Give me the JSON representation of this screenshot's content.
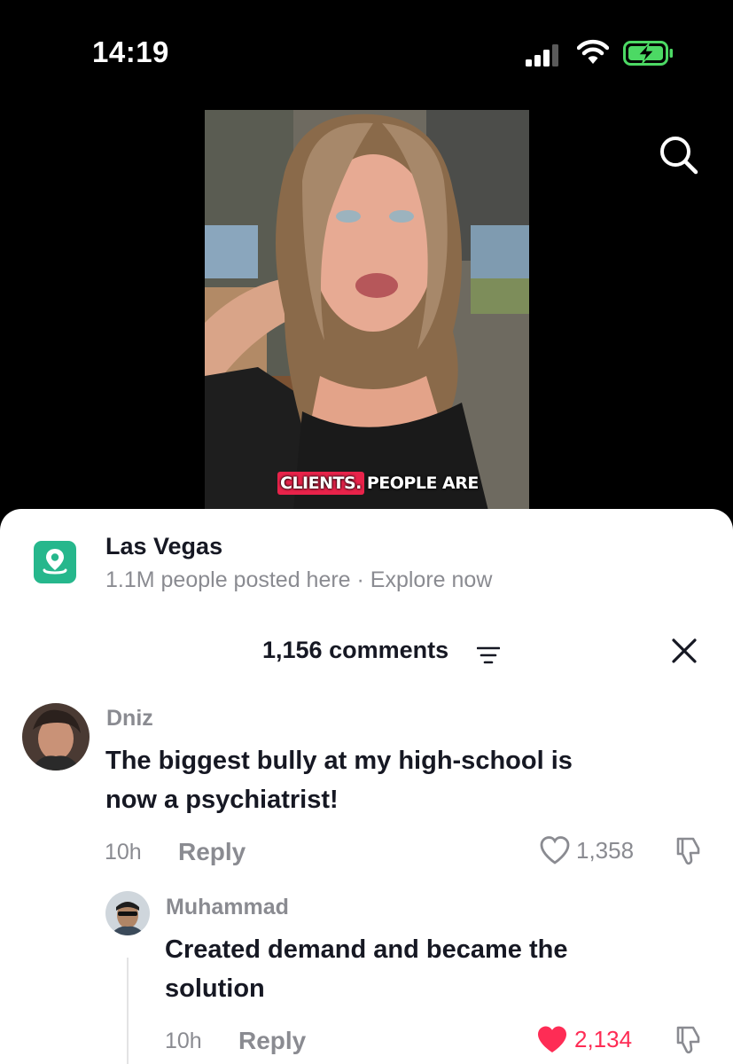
{
  "status": {
    "time": "14:19"
  },
  "video": {
    "caption_highlight": "CLIENTS.",
    "caption_rest": "PEOPLE ARE"
  },
  "location": {
    "name": "Las Vegas",
    "subtitle": "1.1M people posted here · Explore now"
  },
  "comments_header": {
    "count_label": "1,156 comments"
  },
  "comments": [
    {
      "username": "Dniz",
      "text_line1": "The biggest bully at my high-school is",
      "text_line2": "now a psychiatrist!",
      "time": "10h",
      "reply_label": "Reply",
      "likes": "1,358",
      "liked": false
    },
    {
      "username": "Muhammad",
      "text_line1": "Created demand and became the",
      "text_line2": "solution",
      "time": "10h",
      "reply_label": "Reply",
      "likes": "2,134",
      "liked": true
    }
  ],
  "colors": {
    "like_active": "#fe2c55",
    "location_icon_bg": "#26b78c",
    "caption_highlight": "#e8234a"
  }
}
